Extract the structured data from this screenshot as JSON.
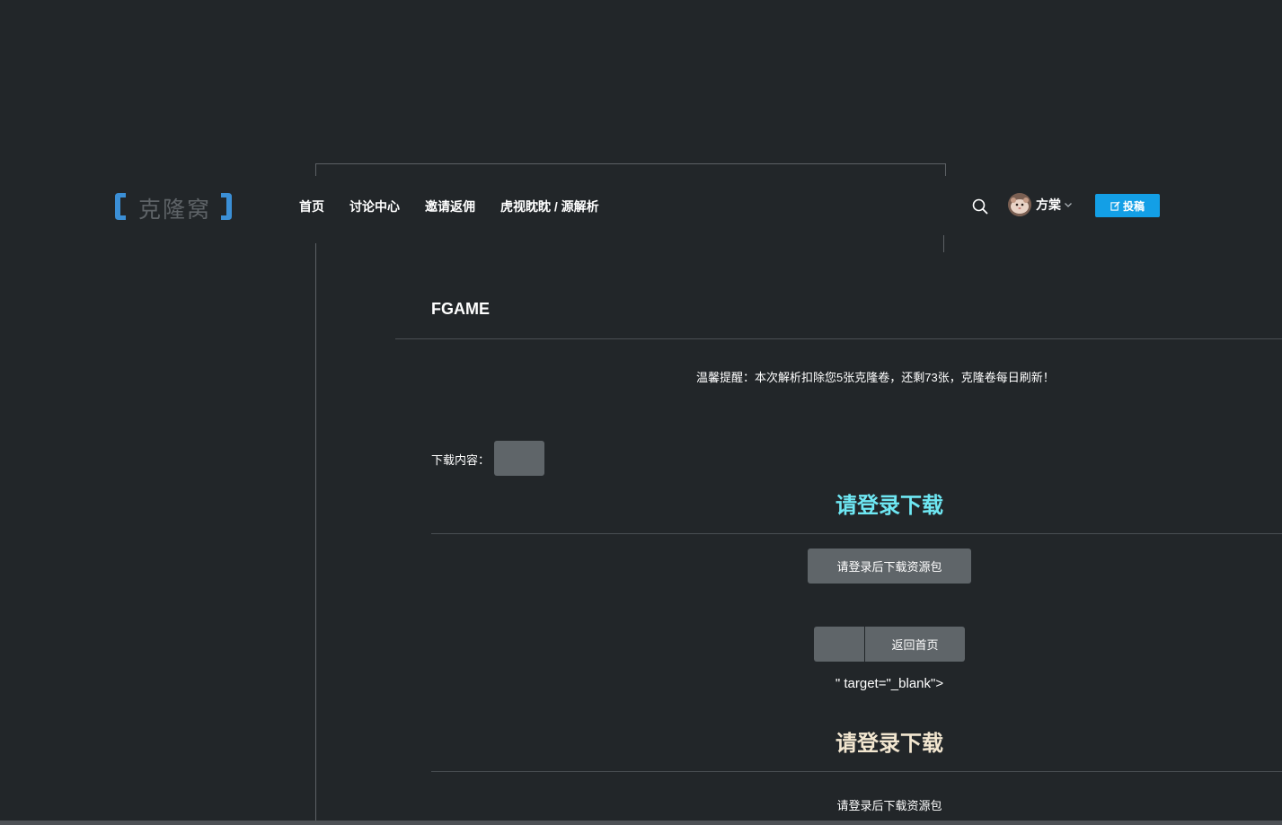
{
  "header": {
    "logo_text": "克隆窝",
    "nav": [
      "首页",
      "讨论中心",
      "邀请返佣",
      "虎视眈眈 / 源解析"
    ],
    "user_name": "方棠",
    "post_label": "投稿",
    "accent": "#139fe6",
    "icons": [
      "search-icon",
      "chevron-down-icon",
      "edit-icon"
    ]
  },
  "content": {
    "title": "FGAME",
    "notice": "温馨提醒：本次解析扣除您5张克隆卷，还剩73张，克隆卷每日刷新！",
    "download_label": "下载内容：",
    "login_heading_1": "请登录下载",
    "download_button_1": "请登录后下载资源包",
    "home_button": "返回首页",
    "stray_text": "\" target=\"_blank\">",
    "login_heading_2": "请登录下载",
    "download_button_2": "请登录后下载资源包",
    "colors": {
      "heading_1": "#6ee7f3",
      "heading_2": "#f2e6d0",
      "button_bg": "#5f6569"
    }
  }
}
